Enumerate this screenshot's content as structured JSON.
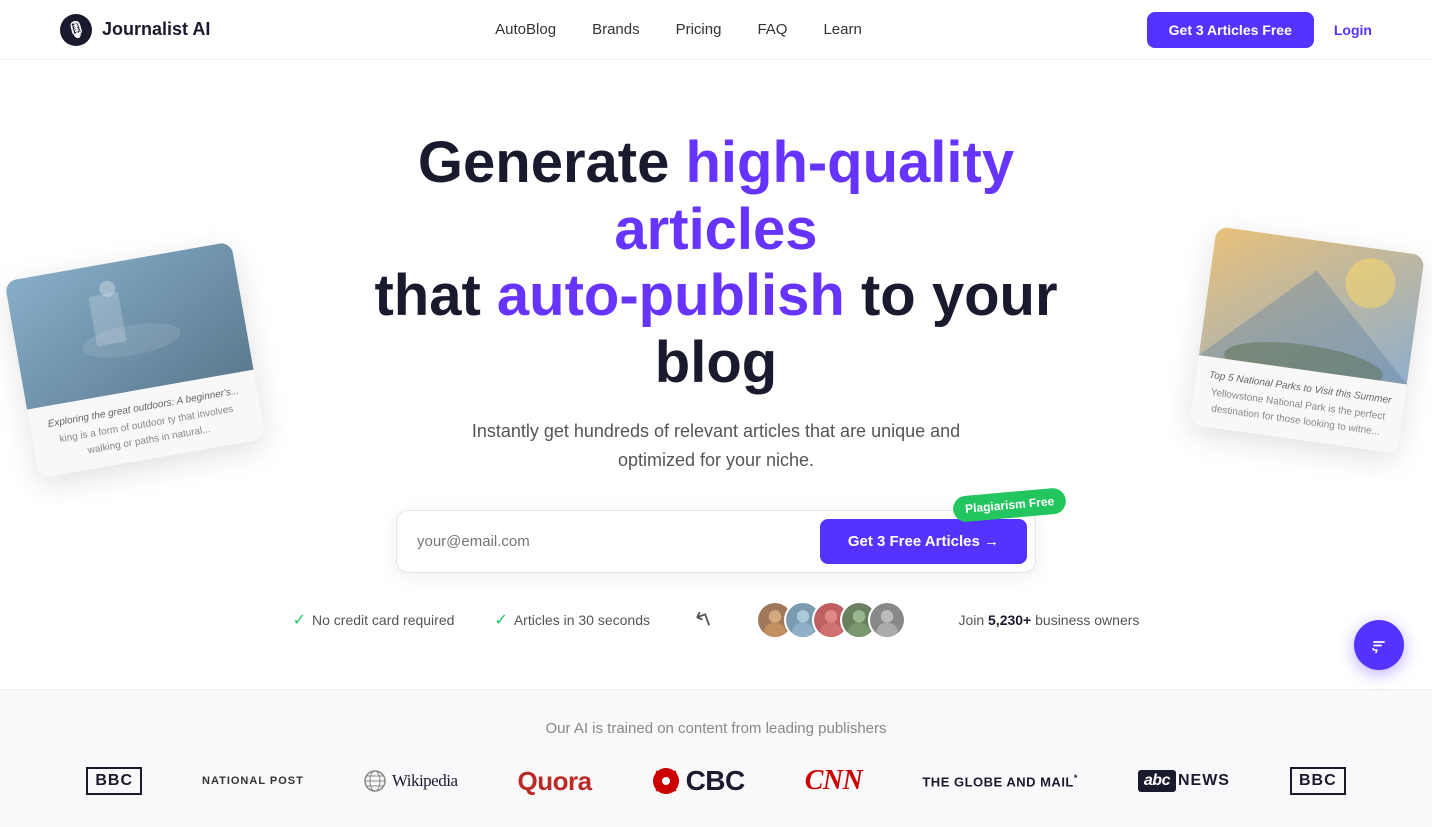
{
  "nav": {
    "logo_text": "Journalist AI",
    "links": [
      {
        "label": "AutoBlog",
        "href": "#"
      },
      {
        "label": "Brands",
        "href": "#"
      },
      {
        "label": "Pricing",
        "href": "#"
      },
      {
        "label": "FAQ",
        "href": "#"
      },
      {
        "label": "Learn",
        "href": "#"
      }
    ],
    "cta_label": "Get 3 Articles Free",
    "login_label": "Login"
  },
  "hero": {
    "title_part1": "Generate ",
    "title_highlight1": "high-quality articles",
    "title_part2": " that ",
    "title_highlight2": "auto-publish",
    "title_part3": " to your blog",
    "subtitle": "Instantly get hundreds of relevant articles that are unique and optimized for your niche.",
    "email_placeholder": "your@email.com",
    "cta_button": "Get 3 Free Articles →",
    "plagiarism_badge": "Plagiarism Free",
    "trust1": "No credit card required",
    "trust2": "Articles in 30 seconds",
    "join_text_prefix": "Join ",
    "join_count": "5,230+",
    "join_text_suffix": " business owners"
  },
  "card_left": {
    "title": "Exploring the great outdoors: A beginner's...",
    "body": "king is a form of outdoor ty that involves walking or paths in natural..."
  },
  "card_right": {
    "title": "Top 5 National Parks to Visit this Summer",
    "body": "Yellowstone National Park is the perfect destination for those looking to witne..."
  },
  "publishers": {
    "subtitle": "Our AI is trained on content from leading publishers",
    "logos": [
      {
        "name": "BBC",
        "type": "bbc"
      },
      {
        "name": "NATIONAL POST",
        "type": "national-post"
      },
      {
        "name": "Wikipedia",
        "type": "wikipedia"
      },
      {
        "name": "Quora",
        "type": "quora"
      },
      {
        "name": "CBC",
        "type": "cbc"
      },
      {
        "name": "CNN",
        "type": "cnn"
      },
      {
        "name": "THE GLOBE AND MAIL*",
        "type": "globe-mail"
      },
      {
        "name": "abcNEWS",
        "type": "abc-news"
      },
      {
        "name": "BBC",
        "type": "bbc2"
      }
    ]
  }
}
